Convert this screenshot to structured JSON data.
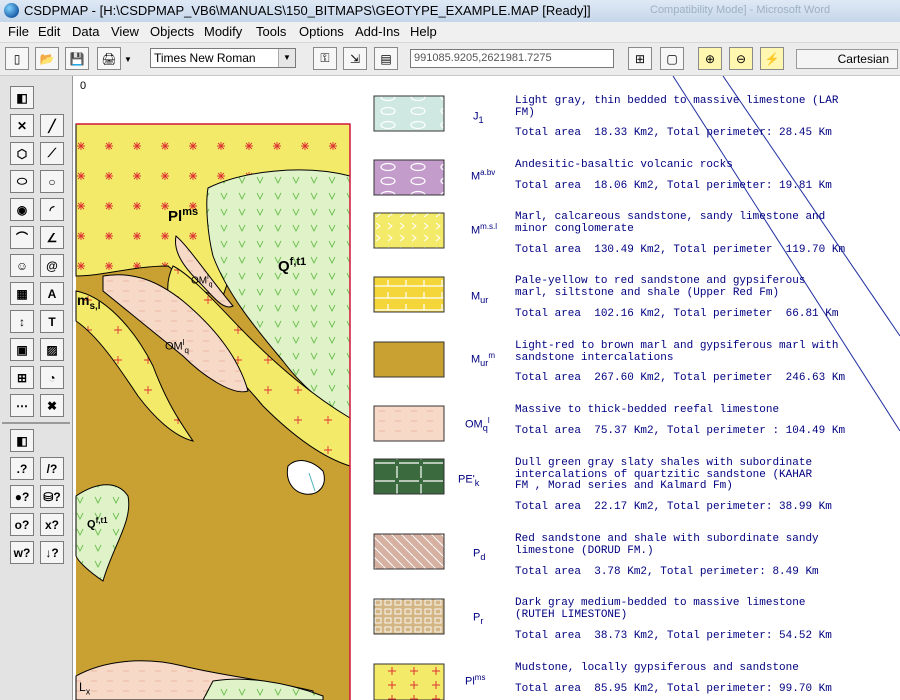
{
  "window": {
    "title": "CSDPMAP - [H:\\CSDPMAP_VB6\\MANUALS\\150_BITMAPS\\GEOTYPE_EXAMPLE.MAP [Ready]]",
    "ghost_text": "Compatibility Mode] - Microsoft Word"
  },
  "menu": [
    "File",
    "Edit",
    "Data",
    "View",
    "Objects",
    "Modify",
    "Tools",
    "Options",
    "Add-Ins",
    "Help"
  ],
  "toolbar": {
    "font": "Times New Roman",
    "coordinates": "991085.9205,2621981.7275",
    "projection": "Cartesian"
  },
  "canvas": {
    "origin_label": "0"
  },
  "map_labels": {
    "pl_ms": "Pl",
    "pl_ms_sup": "ms",
    "q_ft1": "Q",
    "q_ft1_sup": "f,t1",
    "om_q1": "OM",
    "om_q1_sup": "l",
    "om_q1_sub": "q",
    "om_q2": "OM",
    "om_q2_sup": "l",
    "om_q2_sub": "q",
    "m_s": "m",
    "m_s_sub": "s,l",
    "q_ft1b": "Q",
    "q_ft1b_sup": "f,t1",
    "pl_x": "L",
    "pl_x_sub": "x"
  },
  "legend": [
    {
      "sym": "J",
      "sub": "1",
      "sup": "",
      "desc": "Light gray, thin bedded to massive limestone (LAR\nFM)",
      "area": "Total area  18.33 Km2, Total perimeter: 28.45 Km",
      "color": "#cfe9e2"
    },
    {
      "sym": "M",
      "sub": "",
      "sup": "a.bv",
      "desc": "Andesitic-basaltic volcanic rocks",
      "area": "Total area  18.06 Km2, Total perimeter: 19.81 Km",
      "color": "#c49ccc"
    },
    {
      "sym": "M",
      "sub": "",
      "sup": "m.s.l",
      "desc": "Marl, calcareous sandstone, sandy limestone and\nminor conglomerate",
      "area": "Total area  130.49 Km2, Total perimeter  119.70 Km",
      "color": "#f4ea6a"
    },
    {
      "sym": "M",
      "sub": "ur",
      "sup": "",
      "desc": "Pale-yellow to red sandstone and gypsiferous\nmarl, siltstone and shale (Upper Red Fm)",
      "area": "Total area  102.16 Km2, Total perimeter  66.81 Km",
      "color": "#f5d63a"
    },
    {
      "sym": "M",
      "sub": "ur",
      "sup": "m",
      "desc": "Light-red to brown marl and gypsiferous marl with\nsandstone intercalations",
      "area": "Total area  267.60 Km2, Total perimeter  246.63 Km",
      "color": "#c9a032"
    },
    {
      "sym": "OM",
      "sub": "q",
      "sup": "l",
      "desc": "Massive to thick-bedded reefal limestone",
      "area": "Total area  75.37 Km2, Total perimeter : 104.49 Km",
      "color": "#f7d9c8"
    },
    {
      "sym": "PE'",
      "sub": "k",
      "sup": "",
      "desc": "Dull green gray slaty shales with subordinate\nintercalations of quartzitic sandstone (KAHAR\nFM , Morad series and Kalmard Fm)",
      "area": "Total area  22.17 Km2, Total perimeter: 38.99 Km",
      "color": "#3a6a3e"
    },
    {
      "sym": "P",
      "sub": "d",
      "sup": "",
      "desc": "Red sandstone and shale with subordinate sandy\nlimestone (DORUD FM.)",
      "area": "Total area  3.78 Km2, Total perimeter: 8.49 Km",
      "color": "#d6b0a0"
    },
    {
      "sym": "P",
      "sub": "r",
      "sup": "",
      "desc": "Dark gray medium-bedded to massive limestone\n(RUTEH LIMESTONE)",
      "area": "Total area  38.73 Km2, Total perimeter: 54.52 Km",
      "color": "#d3b684"
    },
    {
      "sym": "Pl",
      "sub": "",
      "sup": "ms",
      "desc": "Mudstone, locally gypsiferous and sandstone",
      "area": "Total area  85.95 Km2, Total perimeter: 99.70 Km",
      "color": "#f4ea6a"
    }
  ]
}
